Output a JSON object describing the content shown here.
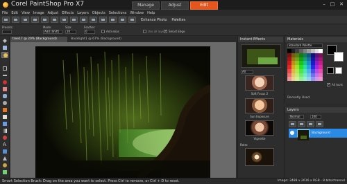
{
  "app": {
    "title": "Corel PaintShop Pro X7"
  },
  "modes": [
    {
      "label": "Manage",
      "active": false
    },
    {
      "label": "Adjust",
      "active": false
    },
    {
      "label": "Edit",
      "active": true
    }
  ],
  "window_controls": {
    "minimize": "–",
    "maximize": "□",
    "close": "✕"
  },
  "menu": [
    "File",
    "Edit",
    "View",
    "Image",
    "Adjust",
    "Effects",
    "Layers",
    "Objects",
    "Selections",
    "Window",
    "Help"
  ],
  "toolbar": {
    "enhance_photo": "Enhance Photo",
    "palettes": "Palettes"
  },
  "options": {
    "presets_label": "Presets:",
    "mode_label": "Mode:",
    "mode_value": "Add (Shift)",
    "size_label": "Size:",
    "size_value": "20",
    "feather_label": "Feather:",
    "feather_value": "0",
    "antialias": "Anti-alias",
    "use_all_layers": "Use all layers",
    "smart_edge": "Smart Edge"
  },
  "doc_tabs": [
    {
      "label": "tree17 @ 20% (Background)",
      "active": true
    },
    {
      "label": "Backlight1 @ 67% (Background)",
      "active": false
    }
  ],
  "effects_panel": {
    "title": "Instant Effects",
    "category": "All",
    "items": [
      {
        "label": "Soft Focus 2"
      },
      {
        "label": "Sun Exposure"
      },
      {
        "label": "Vignette"
      }
    ],
    "section": "Retro"
  },
  "materials_panel": {
    "title": "Materials",
    "palette_select": "Standard Palette",
    "all_tools": "All tools",
    "recently_used": "Recently Used"
  },
  "layers_panel": {
    "title": "Layers",
    "blend_mode": "Normal",
    "opacity": "100",
    "layer_name": "Background"
  },
  "status": {
    "message": "Smart Selection Brush: Drag on the area you want to select. Press Ctrl to remove, or Ctrl + D to reset.",
    "image_info": "Image: 3488 x 2616 x RGB - 8 bits/channel"
  },
  "colors": {
    "accent": "#e8551c",
    "layer_highlight": "#2a8ae6"
  }
}
